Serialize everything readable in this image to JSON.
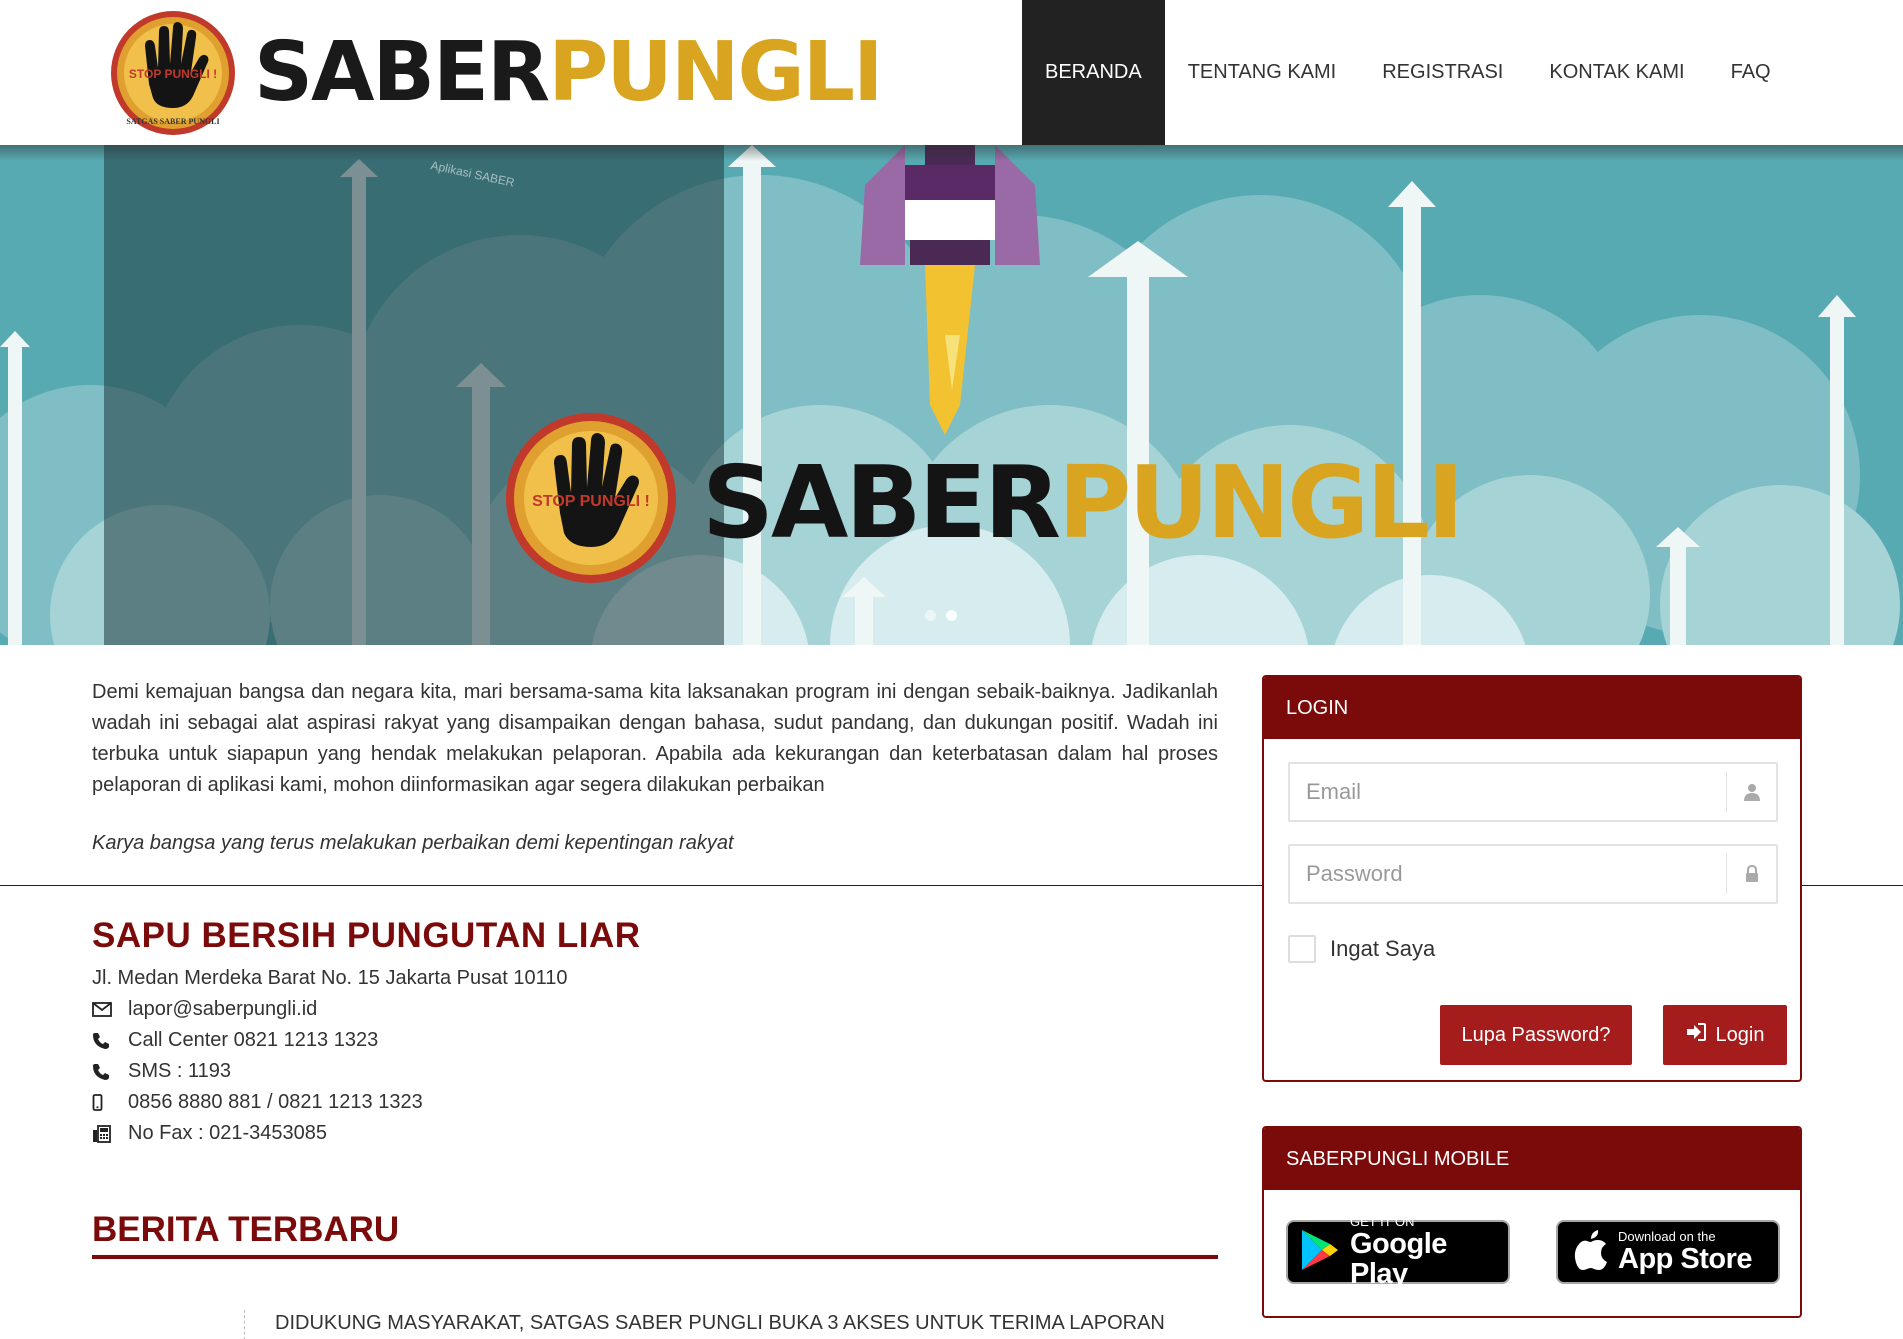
{
  "header": {
    "brand_part1": "SABER",
    "brand_part2": "PUNGLI",
    "logo_text_top": "STOP PUNGLI !",
    "logo_text_bottom": "SATGAS SABER PUNGLI",
    "nav": [
      {
        "label": "BERANDA",
        "active": true
      },
      {
        "label": "TENTANG KAMI",
        "active": false
      },
      {
        "label": "REGISTRASI",
        "active": false
      },
      {
        "label": "KONTAK KAMI",
        "active": false
      },
      {
        "label": "FAQ",
        "active": false
      }
    ]
  },
  "hero": {
    "brand_part1": "SABER",
    "brand_part2": "PUNGLI",
    "watermark": "Aplikasi SABER",
    "slides": 2,
    "active_slide": 2
  },
  "intro": {
    "paragraph": "Demi kemajuan bangsa dan negara kita, mari bersama-sama kita laksanakan program ini dengan sebaik-baiknya. Jadikanlah wadah ini sebagai alat aspirasi rakyat yang disampaikan dengan bahasa, sudut pandang, dan dukungan positif. Wadah ini terbuka untuk siapapun yang hendak melakukan pelaporan. Apabila ada kekurangan dan keterbatasan dalam hal proses pelaporan di aplikasi kami, mohon diinformasikan agar segera dilakukan perbaikan",
    "tagline": "Karya bangsa yang terus melakukan perbaikan demi kepentingan rakyat"
  },
  "contact": {
    "title": "SAPU BERSIH PUNGUTAN LIAR",
    "address": "Jl. Medan Merdeka Barat No. 15 Jakarta Pusat 10110",
    "email": "lapor@saberpungli.id",
    "call_center": "Call Center 0821 1213 1323",
    "sms": "SMS : 1193",
    "mobile": "0856 8880 881 / 0821 1213 1323",
    "fax": "No Fax : 021-3453085"
  },
  "news": {
    "title": "BERITA TERBARU",
    "items": [
      "DIDUKUNG MASYARAKAT, SATGAS SABER PUNGLI BUKA 3 AKSES UNTUK TERIMA LAPORAN"
    ]
  },
  "login": {
    "title": "LOGIN",
    "email_placeholder": "Email",
    "password_placeholder": "Password",
    "remember_label": "Ingat Saya",
    "forgot_label": "Lupa Password?",
    "login_label": "Login"
  },
  "mobile": {
    "title": "SABERPUNGLI MOBILE",
    "google_small": "GET IT ON",
    "google_big": "Google Play",
    "apple_small": "Download on the",
    "apple_big": "App Store"
  },
  "colors": {
    "brand_dark": "#1a1a1a",
    "brand_gold": "#d9a520",
    "accent_red": "#7b0a0a",
    "button_red": "#a51c1c",
    "nav_active": "#222222",
    "hero_teal": "#4da3ab"
  }
}
